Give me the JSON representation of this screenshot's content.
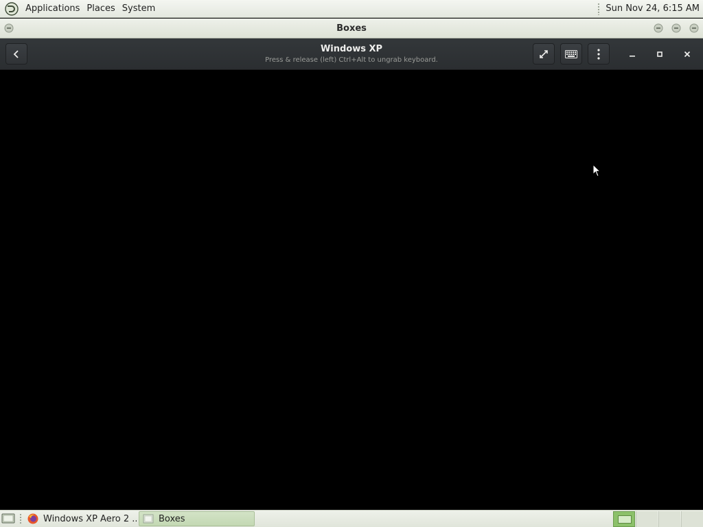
{
  "top_panel": {
    "menus": [
      "Applications",
      "Places",
      "System"
    ],
    "clock": "Sun Nov 24,  6:15 AM"
  },
  "window": {
    "title": "Boxes"
  },
  "headerbar": {
    "title": "Windows XP",
    "subtitle": "Press & release (left) Ctrl+Alt to ungrab keyboard."
  },
  "taskbar": {
    "tasks": [
      {
        "label": "Windows XP Aero 2 ...",
        "icon": "firefox-icon",
        "active": false
      },
      {
        "label": "Boxes",
        "icon": "boxes-app-icon",
        "active": true
      }
    ],
    "workspaces": {
      "count": 4,
      "active": 1
    }
  },
  "colors": {
    "panel_bg": "#e4e8df",
    "headerbar_bg": "#2f3235",
    "display_bg": "#000000",
    "active_workspace": "#8cc16a"
  }
}
